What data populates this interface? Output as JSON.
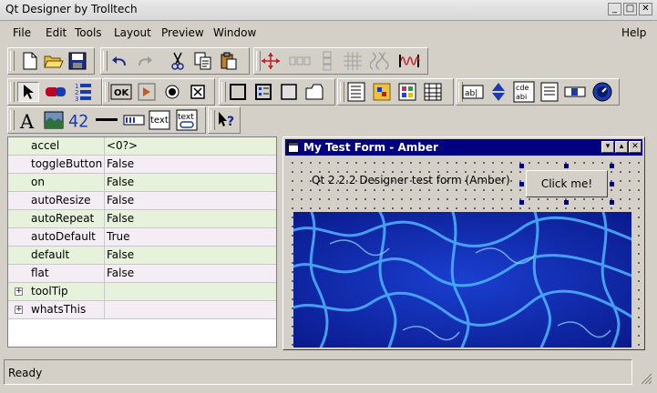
{
  "window": {
    "title": "Qt Designer by Trolltech",
    "minimize_glyph": "_",
    "maximize_glyph": "□",
    "close_glyph": "✕"
  },
  "menubar": {
    "items": [
      "File",
      "Edit",
      "Tools",
      "Layout",
      "Preview",
      "Window"
    ],
    "help": "Help"
  },
  "toolbar": {
    "file_tools": [
      "new-file-icon",
      "open-folder-icon",
      "save-icon"
    ],
    "edit_tools": [
      "undo-icon",
      "redo-icon",
      "cut-icon",
      "copy-icon",
      "paste-icon"
    ],
    "layout_tools": [
      "adjust-size-icon",
      "layout-horizontal-icon",
      "layout-vertical-icon",
      "layout-grid-icon",
      "break-layout-icon",
      "spacer-icon"
    ],
    "pointer_tools": [
      "pointer-icon",
      "connect-signals-icon",
      "tab-order-icon"
    ],
    "button_widgets": [
      "pushbutton-icon",
      "toolbutton-icon",
      "radiobutton-icon",
      "checkbox-icon"
    ],
    "container_widgets": [
      "groupbox-icon",
      "buttongroup-icon",
      "frame-icon",
      "tabwidget-icon"
    ],
    "view_widgets": [
      "listbox-icon",
      "iconview-icon",
      "listview-icon",
      "table-icon"
    ],
    "input_widgets": [
      "lineedit-icon",
      "spinbox-icon",
      "multilineedit-icon",
      "combobox-icon",
      "slider-icon",
      "dial-icon"
    ],
    "display_widgets": [
      "label-icon",
      "pixmap-label-icon",
      "lcdnumber-icon",
      "line-icon",
      "progressbar-icon",
      "textview-icon",
      "textbrowser-icon"
    ],
    "help_tools": [
      "whats-this-icon"
    ],
    "icon_texts": {
      "lcd": "42",
      "text": "text",
      "lineedit": "ab|",
      "multiline": "cde abi",
      "pushbutton": "OK",
      "label": "A"
    }
  },
  "properties": [
    {
      "name": "accel",
      "value": "<0?>",
      "expandable": false
    },
    {
      "name": "toggleButton",
      "value": "False",
      "expandable": false
    },
    {
      "name": "on",
      "value": "False",
      "expandable": false
    },
    {
      "name": "autoResize",
      "value": "False",
      "expandable": false
    },
    {
      "name": "autoRepeat",
      "value": "False",
      "expandable": false
    },
    {
      "name": "autoDefault",
      "value": "True",
      "expandable": false
    },
    {
      "name": "default",
      "value": "False",
      "expandable": false
    },
    {
      "name": "flat",
      "value": "False",
      "expandable": false
    },
    {
      "name": "toolTip",
      "value": "",
      "expandable": true
    },
    {
      "name": "whatsThis",
      "value": "",
      "expandable": true
    }
  ],
  "form": {
    "title": "My Test Form - Amber",
    "label_text": "Qt 2.2.2 Designer test form (Amber)",
    "button_text": "Click me!",
    "image": "water-caustics-pixmap",
    "glyphs": {
      "menu": "▾",
      "shade": "▴",
      "close": "✕"
    }
  },
  "statusbar": {
    "text": "Ready"
  },
  "colors": {
    "form_title_bg": "#000080",
    "prop_row_even": "#e6f2dc",
    "prop_row_odd": "#f4eef4",
    "selection_handle": "#000080",
    "water_dark": "#0a1a8c",
    "water_light": "#4fb4ff"
  }
}
